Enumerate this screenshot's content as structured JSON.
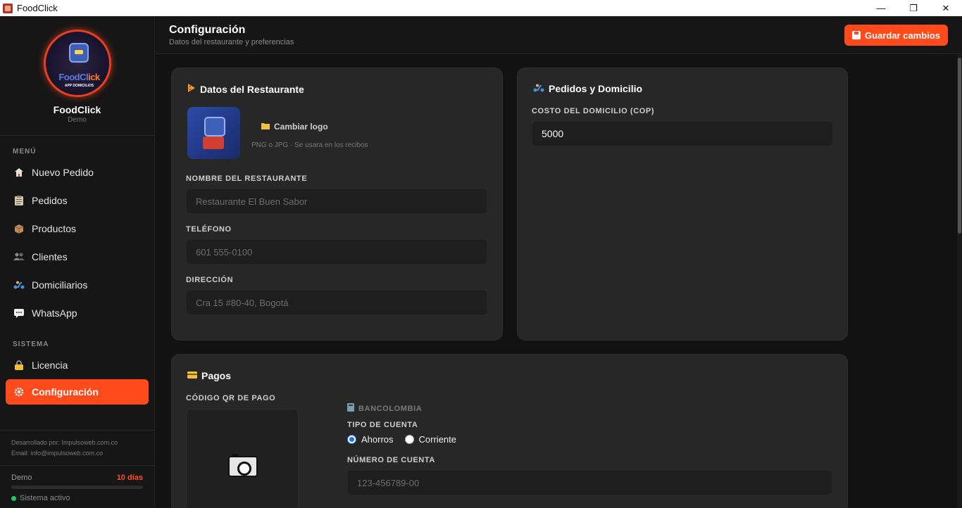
{
  "window": {
    "title": "FoodClick",
    "min_glyph": "—",
    "restore_glyph": "❐",
    "close_glyph": "✕"
  },
  "brand": {
    "name": "FoodClick",
    "plan": "Demo",
    "logo_text_a": "FoodCl",
    "logo_text_b": "ick",
    "logo_sub": "APP DOMICILIOS"
  },
  "sidebar": {
    "menu_title": "MENÚ",
    "items": [
      {
        "label": "Nuevo Pedido",
        "icon": "home-icon"
      },
      {
        "label": "Pedidos",
        "icon": "clipboard-icon"
      },
      {
        "label": "Productos",
        "icon": "box-icon"
      },
      {
        "label": "Clientes",
        "icon": "users-icon"
      },
      {
        "label": "Domiciliarios",
        "icon": "scooter-icon"
      },
      {
        "label": "WhatsApp",
        "icon": "chat-icon"
      }
    ],
    "system_title": "SISTEMA",
    "system_items": [
      {
        "label": "Licencia",
        "icon": "lock-icon"
      },
      {
        "label": "Configuración",
        "icon": "gear-icon",
        "active": true
      }
    ],
    "dev_by": "Desarrollado por: Impulsoweb.com.co",
    "dev_email": "Email: info@impulsoweb.com.co",
    "license": {
      "plan": "Demo",
      "days_left": "10 días",
      "progress": 0.0,
      "status": "Sistema activo"
    }
  },
  "header": {
    "title": "Configuración",
    "subtitle": "Datos del restaurante y preferencias",
    "save_label": "Guardar cambios"
  },
  "restaurant": {
    "title": "Datos del Restaurante",
    "change_logo": "Cambiar logo",
    "logo_hint": "PNG o JPG · Se usara en los recibos",
    "name_label": "NOMBRE DEL RESTAURANTE",
    "name_placeholder": "Restaurante El Buen Sabor",
    "phone_label": "TELÉFONO",
    "phone_placeholder": "601 555-0100",
    "address_label": "DIRECCIÓN",
    "address_placeholder": "Cra 15 #80-40, Bogotá"
  },
  "delivery": {
    "title": "Pedidos y Domicilio",
    "cost_label": "COSTO DEL DOMICILIO (COP)",
    "cost_value": "5000"
  },
  "payments": {
    "title": "Pagos",
    "qr_label": "CÓDIGO QR DE PAGO",
    "bank": "BANCOLOMBIA",
    "account_type_label": "TIPO DE CUENTA",
    "account_type_options": [
      "Ahorros",
      "Corriente"
    ],
    "account_type_selected": "Ahorros",
    "account_number_label": "NÚMERO DE CUENTA",
    "account_number_placeholder": "123-456789-00"
  },
  "colors": {
    "accent": "#ff4a1c",
    "bg": "#121212",
    "card": "#272727",
    "status_ok": "#22c55e"
  }
}
